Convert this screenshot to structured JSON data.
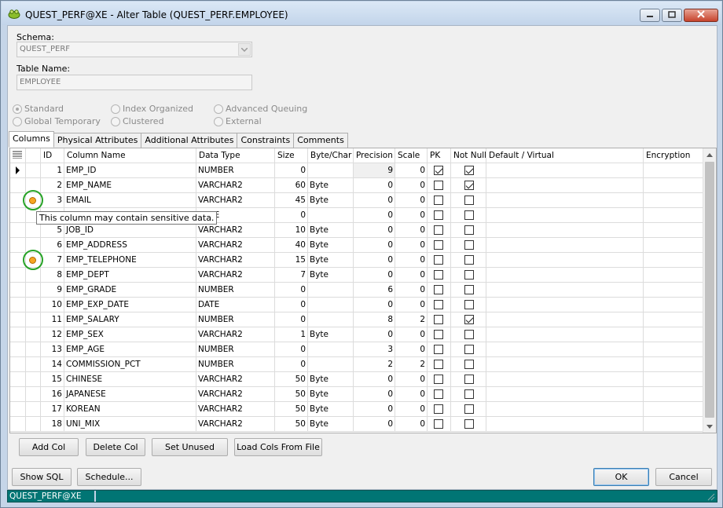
{
  "window": {
    "title": "QUEST_PERF@XE - Alter Table (QUEST_PERF.EMPLOYEE)",
    "minimize_icon": "minimize-icon",
    "maximize_icon": "maximize-icon",
    "close_icon": "close-icon"
  },
  "form": {
    "schema_label": "Schema:",
    "schema_value": "QUEST_PERF",
    "table_name_label": "Table Name:",
    "table_name_value": "EMPLOYEE"
  },
  "table_types": [
    {
      "label": "Standard",
      "selected": true
    },
    {
      "label": "Global Temporary",
      "selected": false
    },
    {
      "label": "Index Organized",
      "selected": false
    },
    {
      "label": "Clustered",
      "selected": false
    },
    {
      "label": "Advanced Queuing",
      "selected": false
    },
    {
      "label": "External",
      "selected": false
    }
  ],
  "tabs": [
    "Columns",
    "Physical Attributes",
    "Additional Attributes",
    "Constraints",
    "Comments"
  ],
  "grid": {
    "headers": {
      "id": "ID",
      "column_name": "Column Name",
      "data_type": "Data Type",
      "size": "Size",
      "byte_char": "Byte/Char",
      "precision": "Precision",
      "scale": "Scale",
      "pk": "PK",
      "not_null": "Not Null",
      "default": "Default / Virtual",
      "encryption": "Encryption"
    },
    "rows": [
      {
        "id": "1",
        "name": "EMP_ID",
        "type": "NUMBER",
        "size": "0",
        "bc": "",
        "precision": "9",
        "scale": "0",
        "pk": true,
        "nn": true,
        "current": true,
        "sensitive": false
      },
      {
        "id": "2",
        "name": "EMP_NAME",
        "type": "VARCHAR2",
        "size": "60",
        "bc": "Byte",
        "precision": "0",
        "scale": "0",
        "pk": false,
        "nn": true,
        "current": false,
        "sensitive": false
      },
      {
        "id": "3",
        "name": "EMAIL",
        "type": "VARCHAR2",
        "size": "45",
        "bc": "Byte",
        "precision": "0",
        "scale": "0",
        "pk": false,
        "nn": false,
        "current": false,
        "sensitive": true
      },
      {
        "id": "4",
        "name": "",
        "type": "DATE",
        "size": "0",
        "bc": "",
        "precision": "0",
        "scale": "0",
        "pk": false,
        "nn": false,
        "current": false,
        "sensitive": false
      },
      {
        "id": "5",
        "name": "JOB_ID",
        "type": "VARCHAR2",
        "size": "10",
        "bc": "Byte",
        "precision": "0",
        "scale": "0",
        "pk": false,
        "nn": false,
        "current": false,
        "sensitive": false
      },
      {
        "id": "6",
        "name": "EMP_ADDRESS",
        "type": "VARCHAR2",
        "size": "40",
        "bc": "Byte",
        "precision": "0",
        "scale": "0",
        "pk": false,
        "nn": false,
        "current": false,
        "sensitive": false
      },
      {
        "id": "7",
        "name": "EMP_TELEPHONE",
        "type": "VARCHAR2",
        "size": "15",
        "bc": "Byte",
        "precision": "0",
        "scale": "0",
        "pk": false,
        "nn": false,
        "current": false,
        "sensitive": true
      },
      {
        "id": "8",
        "name": "EMP_DEPT",
        "type": "VARCHAR2",
        "size": "7",
        "bc": "Byte",
        "precision": "0",
        "scale": "0",
        "pk": false,
        "nn": false,
        "current": false,
        "sensitive": false
      },
      {
        "id": "9",
        "name": "EMP_GRADE",
        "type": "NUMBER",
        "size": "0",
        "bc": "",
        "precision": "6",
        "scale": "0",
        "pk": false,
        "nn": false,
        "current": false,
        "sensitive": false
      },
      {
        "id": "10",
        "name": "EMP_EXP_DATE",
        "type": "DATE",
        "size": "0",
        "bc": "",
        "precision": "0",
        "scale": "0",
        "pk": false,
        "nn": false,
        "current": false,
        "sensitive": false
      },
      {
        "id": "11",
        "name": "EMP_SALARY",
        "type": "NUMBER",
        "size": "0",
        "bc": "",
        "precision": "8",
        "scale": "2",
        "pk": false,
        "nn": true,
        "current": false,
        "sensitive": false
      },
      {
        "id": "12",
        "name": "EMP_SEX",
        "type": "VARCHAR2",
        "size": "1",
        "bc": "Byte",
        "precision": "0",
        "scale": "0",
        "pk": false,
        "nn": false,
        "current": false,
        "sensitive": false
      },
      {
        "id": "13",
        "name": "EMP_AGE",
        "type": "NUMBER",
        "size": "0",
        "bc": "",
        "precision": "3",
        "scale": "0",
        "pk": false,
        "nn": false,
        "current": false,
        "sensitive": false
      },
      {
        "id": "14",
        "name": "COMMISSION_PCT",
        "type": "NUMBER",
        "size": "0",
        "bc": "",
        "precision": "2",
        "scale": "2",
        "pk": false,
        "nn": false,
        "current": false,
        "sensitive": false
      },
      {
        "id": "15",
        "name": "CHINESE",
        "type": "VARCHAR2",
        "size": "50",
        "bc": "Byte",
        "precision": "0",
        "scale": "0",
        "pk": false,
        "nn": false,
        "current": false,
        "sensitive": false
      },
      {
        "id": "16",
        "name": "JAPANESE",
        "type": "VARCHAR2",
        "size": "50",
        "bc": "Byte",
        "precision": "0",
        "scale": "0",
        "pk": false,
        "nn": false,
        "current": false,
        "sensitive": false
      },
      {
        "id": "17",
        "name": "KOREAN",
        "type": "VARCHAR2",
        "size": "50",
        "bc": "Byte",
        "precision": "0",
        "scale": "0",
        "pk": false,
        "nn": false,
        "current": false,
        "sensitive": false
      },
      {
        "id": "18",
        "name": "UNI_MIX",
        "type": "VARCHAR2",
        "size": "50",
        "bc": "Byte",
        "precision": "0",
        "scale": "0",
        "pk": false,
        "nn": false,
        "current": false,
        "sensitive": false
      }
    ],
    "tooltip": "This column may contain sensitive data."
  },
  "grid_buttons": {
    "add_col": "Add Col",
    "delete_col": "Delete Col",
    "set_unused": "Set Unused",
    "load_cols": "Load Cols From File"
  },
  "footer_buttons": {
    "show_sql": "Show SQL",
    "schedule": "Schedule...",
    "ok": "OK",
    "cancel": "Cancel"
  },
  "statusbar": {
    "connection": "QUEST_PERF@XE"
  },
  "colors": {
    "statusbar": "#017574",
    "sensitive_marker": "#f5a623",
    "sensitive_ring": "#27a327"
  }
}
